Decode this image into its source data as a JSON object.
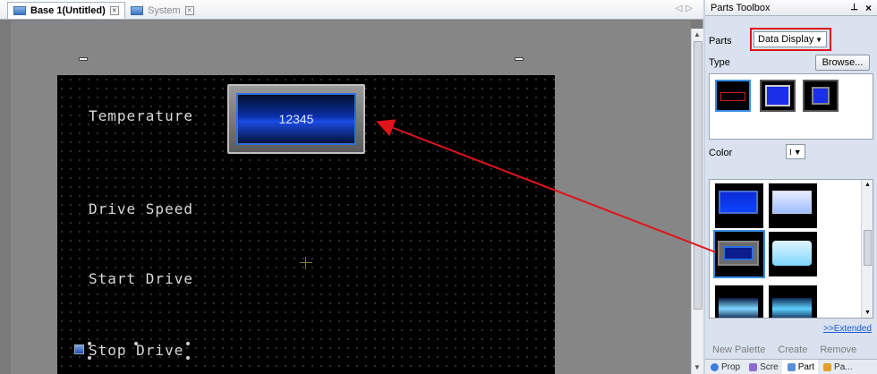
{
  "tabs": [
    {
      "label": "Base 1(Untitled)",
      "active": true
    },
    {
      "label": "System",
      "active": false
    }
  ],
  "screen": {
    "labels": [
      "Temperature",
      "Drive Speed",
      "Start Drive",
      "Stop Drive"
    ],
    "display_value": "12345"
  },
  "toolbox": {
    "title": "Parts Toolbox",
    "parts_label": "Parts",
    "parts_value": "Data Display",
    "type_label": "Type",
    "browse_label": "Browse...",
    "color_label": "Color",
    "color_value": "I",
    "extended_link": ">>Extended",
    "links": [
      "New Palette",
      "Create",
      "Remove"
    ],
    "bottom_tabs": [
      "Prop",
      "Scre",
      "Part",
      "Pa..."
    ]
  },
  "colors": {
    "highlight": "#e0141b",
    "arrow": "#e0141b",
    "link": "#1a5ad6"
  },
  "icons": [
    "tab-screen-icon",
    "close-icon",
    "pin-icon",
    "dropdown-icon"
  ]
}
